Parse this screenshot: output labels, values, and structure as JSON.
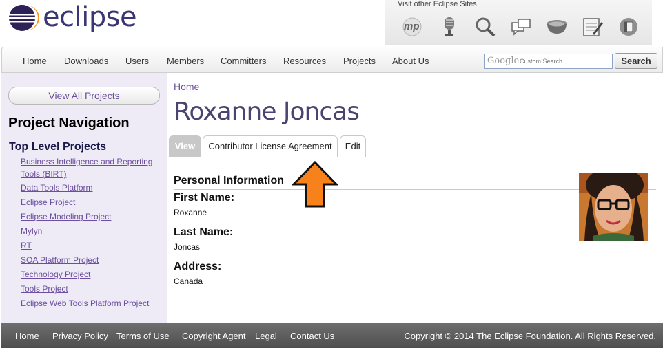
{
  "header": {
    "logo_text": "eclipse",
    "other_sites_label": "Visit other Eclipse Sites",
    "site_icons": [
      "marketplace-icon",
      "microphone-icon",
      "magnifier-icon",
      "chat-bubbles-icon",
      "pot-icon",
      "notepad-icon",
      "book-icon"
    ],
    "mp_text": "mp"
  },
  "nav": {
    "items": [
      "Home",
      "Downloads",
      "Users",
      "Members",
      "Committers",
      "Resources",
      "Projects",
      "About Us"
    ],
    "search_logo": "Google",
    "search_placeholder": "Custom Search",
    "search_button": "Search"
  },
  "sidebar": {
    "view_all": "View All Projects",
    "title": "Project Navigation",
    "subtitle": "Top Level Projects",
    "projects": [
      "Business Intelligence and Reporting Tools (BIRT)",
      "Data Tools Platform",
      "Eclipse Project",
      "Eclipse Modeling Project",
      "Mylyn",
      "RT",
      "SOA Platform Project",
      "Technology Project",
      "Tools Project",
      "Eclipse Web Tools Platform Project"
    ]
  },
  "main": {
    "breadcrumb": "Home",
    "title": "Roxanne Joncas",
    "tabs": [
      "View",
      "Contributor License Agreement",
      "Edit"
    ],
    "section_title": "Personal Information",
    "fields": [
      {
        "label": "First Name:",
        "value": "Roxanne"
      },
      {
        "label": "Last Name:",
        "value": "Joncas"
      },
      {
        "label": "Address:",
        "value": "Canada"
      }
    ]
  },
  "footer": {
    "links": [
      "Home",
      "Privacy Policy",
      "Terms of Use",
      "Copyright Agent",
      "Legal",
      "Contact Us"
    ],
    "copyright": "Copyright © 2014 The Eclipse Foundation. All Rights Reserved."
  },
  "colors": {
    "brand": "#3a3573",
    "link": "#6b4f9e",
    "arrow": "#f7821b",
    "sidebar_bg": "#eeeaf6",
    "footer_bg": "#5a5a5a"
  }
}
